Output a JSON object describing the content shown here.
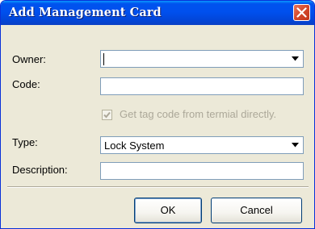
{
  "window": {
    "title": "Add Management Card"
  },
  "form": {
    "owner_label": "Owner:",
    "owner_value": "",
    "code_label": "Code:",
    "code_value": "",
    "get_tag_label": "Get tag code from termial directly.",
    "get_tag_checked": true,
    "get_tag_enabled": false,
    "type_label": "Type:",
    "type_value": "Lock System",
    "description_label": "Description:",
    "description_value": ""
  },
  "buttons": {
    "ok": "OK",
    "cancel": "Cancel"
  },
  "colors": {
    "titlebar": "#0053ee",
    "close": "#d3482b",
    "dialog_bg": "#ece9d8",
    "field_border": "#7f9db9"
  }
}
